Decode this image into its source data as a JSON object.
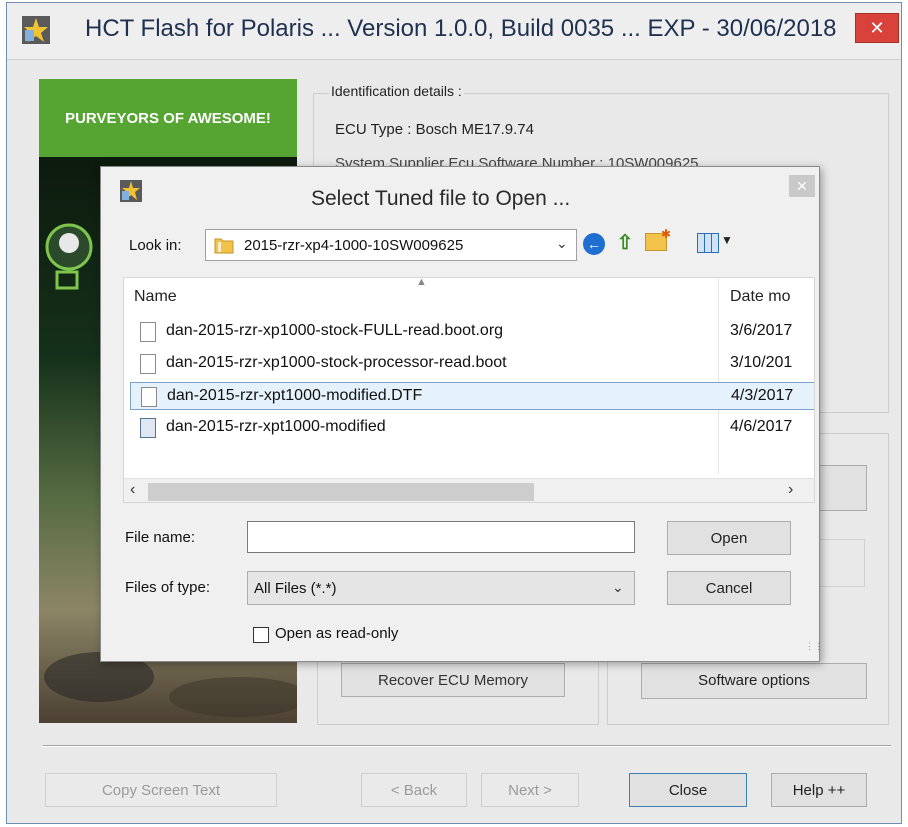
{
  "window": {
    "title": "HCT Flash for Polaris ... Version 1.0.0, Build 0035 ... EXP - 30/06/2018",
    "close_glyph": "✕"
  },
  "left_panel": {
    "banner_text": "PURVEYORS OF AWESOME!"
  },
  "identification": {
    "title": "Identification details :",
    "ecu_type": "ECU Type : Bosch ME17.9.74",
    "system_line": "System Supplier Ecu Software Number : 10SW009625"
  },
  "buttons": {
    "recover_label": "Recover ECU Memory",
    "software_label": "Software options",
    "copy_label": "Copy Screen Text",
    "back_label": "< Back",
    "next_label": "Next >",
    "close_label": "Close",
    "help_label": "Help ++"
  },
  "dialog": {
    "title": "Select Tuned file to Open ...",
    "close_glyph": "✕",
    "look_in_label": "Look in:",
    "look_in_value": "2015-rzr-xp4-1000-10SW009625",
    "column_name": "Name",
    "column_date": "Date mo",
    "files": [
      {
        "name": "dan-2015-rzr-xp1000-stock-FULL-read.boot.org",
        "date": "3/6/2017",
        "selected": false,
        "icon": "document-icon"
      },
      {
        "name": "dan-2015-rzr-xp1000-stock-processor-read.boot",
        "date": "3/10/201",
        "selected": false,
        "icon": "document-icon"
      },
      {
        "name": "dan-2015-rzr-xpt1000-modified.DTF",
        "date": "4/3/2017",
        "selected": true,
        "icon": "document-icon"
      },
      {
        "name": "dan-2015-rzr-xpt1000-modified",
        "date": "4/6/2017",
        "selected": false,
        "icon": "application-icon"
      }
    ],
    "file_name_label": "File name:",
    "file_name_value": "",
    "files_of_type_label": "Files of type:",
    "files_of_type_value": "All Files (*.*)",
    "open_label": "Open",
    "cancel_label": "Cancel",
    "read_only_label": "Open as read-only",
    "read_only_checked": false
  }
}
